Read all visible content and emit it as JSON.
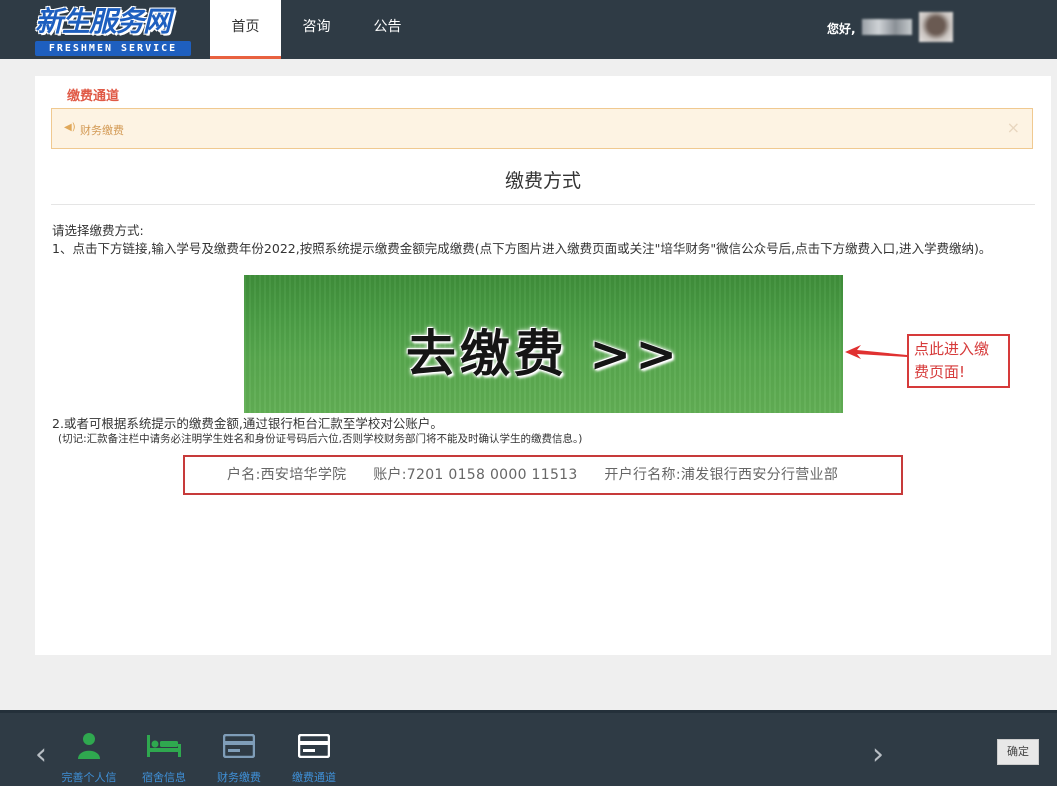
{
  "header": {
    "logo_main": "新生服务网",
    "logo_sub": "FRESHMEN SERVICE",
    "nav": [
      {
        "label": "首页",
        "active": true
      },
      {
        "label": "咨询",
        "active": false
      },
      {
        "label": "公告",
        "active": false
      }
    ],
    "greeting": "您好,"
  },
  "main": {
    "section_tag": "缴费通道",
    "alert_text": "财务缴费",
    "alert_close": "×",
    "title": "缴费方式",
    "intro": "请选择缴费方式:",
    "step1": "1、点击下方链接,输入学号及缴费年份2022,按照系统提示缴费金额完成缴费(点下方图片进入缴费页面或关注\"培华财务\"微信公众号后,点击下方缴费入口,进入学费缴纳)。",
    "banner_text": "去缴费 >>",
    "callout_line1": "点此进入缴",
    "callout_line2": "费页面!",
    "step2": "2.或者可根据系统提示的缴费金额,通过银行柜台汇款至学校对公账户。",
    "note": "(切记:汇款备注栏中请务必注明学生姓名和身份证号码后六位,否则学校财务部门将不能及时确认学生的缴费信息。)",
    "account": {
      "name": "户名:西安培华学院",
      "number": "账户:7201 0158 0000 11513",
      "bank": "开户行名称:浦发银行西安分行营业部"
    }
  },
  "footer": {
    "prev": "‹",
    "next": "›",
    "steps": [
      {
        "label": "完善个人信",
        "icon": "person-icon",
        "color": "#2fa84f"
      },
      {
        "label": "宿舍信息",
        "icon": "bed-icon",
        "color": "#2fa84f"
      },
      {
        "label": "财务缴费",
        "icon": "card-icon",
        "color": "#7f9db8"
      },
      {
        "label": "缴费通道",
        "icon": "card-icon",
        "color": "#ffffff"
      }
    ],
    "confirm": "确定"
  }
}
